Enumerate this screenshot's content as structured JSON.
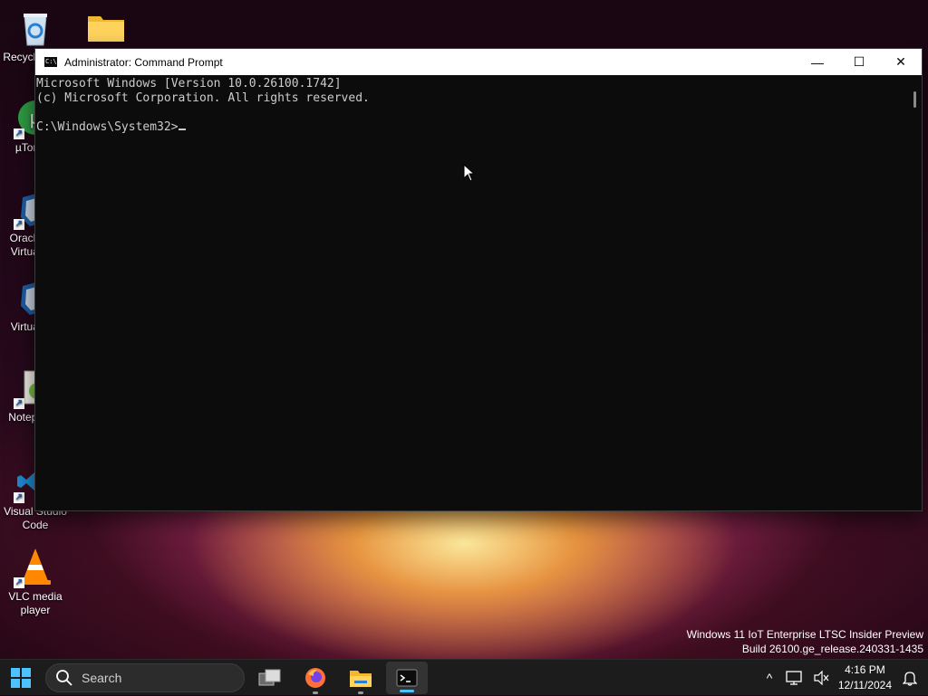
{
  "window": {
    "title": "Administrator: Command Prompt",
    "title_icon": "C:\\",
    "minimize_glyph": "—",
    "maximize_glyph": "☐",
    "close_glyph": "✕"
  },
  "console": {
    "line1": "Microsoft Windows [Version 10.0.26100.1742]",
    "line2": "(c) Microsoft Corporation. All rights reserved.",
    "prompt": "C:\\Windows\\System32>"
  },
  "desktop": {
    "icons": [
      {
        "label": "Recycle Bin",
        "icon": "recycle-bin-icon"
      },
      {
        "label": "",
        "icon": "folder-icon"
      },
      {
        "label": "µTorrent",
        "icon": "utorrent-icon"
      },
      {
        "label": "Oracle VM VirtualBox",
        "icon": "virtualbox-icon"
      },
      {
        "label": "VirtualBox",
        "icon": "virtualbox-icon"
      },
      {
        "label": "Notepad++",
        "icon": "notepad-plus-plus-icon"
      },
      {
        "label": "Visual Studio Code",
        "icon": "vscode-icon"
      },
      {
        "label": "VLC media player",
        "icon": "vlc-icon"
      }
    ],
    "watermark_line1": "Windows 11 IoT Enterprise LTSC Insider Preview",
    "watermark_line2": "Build 26100.ge_release.240331-1435"
  },
  "taskbar": {
    "start_icon": "windows-start-icon",
    "search_placeholder": "Search",
    "apps": [
      "task-view-icon",
      "firefox-icon",
      "file-explorer-icon",
      "terminal-icon"
    ],
    "tray_chevron": "^",
    "time": "4:16 PM",
    "date": "12/11/2024"
  },
  "colors": {
    "console_bg": "#0c0c0c",
    "console_text": "#cccccc",
    "taskbar_bg": "#1c1c1c",
    "accent": "#0078d4"
  }
}
